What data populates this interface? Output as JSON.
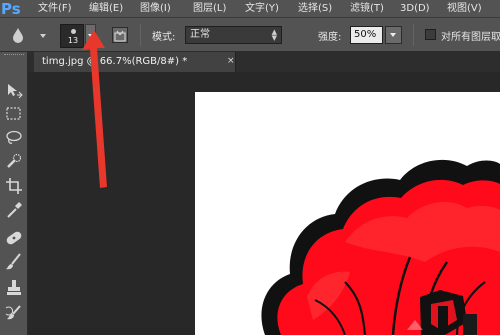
{
  "app": {
    "logo": "Ps"
  },
  "menubar": {
    "items": [
      {
        "label": "文件(F)"
      },
      {
        "label": "编辑(E)"
      },
      {
        "label": "图像(I)"
      },
      {
        "label": "图层(L)"
      },
      {
        "label": "文字(Y)"
      },
      {
        "label": "选择(S)"
      },
      {
        "label": "滤镜(T)"
      },
      {
        "label": "3D(D)"
      },
      {
        "label": "视图(V)"
      }
    ]
  },
  "options": {
    "brush_size": "13",
    "mode_label": "模式:",
    "mode_value": "正常",
    "strength_label": "强度:",
    "strength_value": "50%",
    "all_layers_label": "对所有图层取"
  },
  "document": {
    "tab_title": "timg.jpg @ 66.7%(RGB/8#) *",
    "close_glyph": "×"
  },
  "colors": {
    "accent": "#56a9ff",
    "chrome": "#535353",
    "workspace": "#282828",
    "flower_red": "#ff0a1a",
    "flower_outline": "#111111",
    "annotation_red": "#e8372b"
  },
  "icons": [
    "tool-preset-icon",
    "brush-panel-icon",
    "move-tool-icon",
    "marquee-tool-icon",
    "lasso-tool-icon",
    "quick-selection-icon",
    "crop-tool-icon",
    "eyedropper-icon",
    "healing-brush-icon",
    "brush-tool-icon",
    "clone-stamp-icon",
    "history-brush-icon"
  ]
}
